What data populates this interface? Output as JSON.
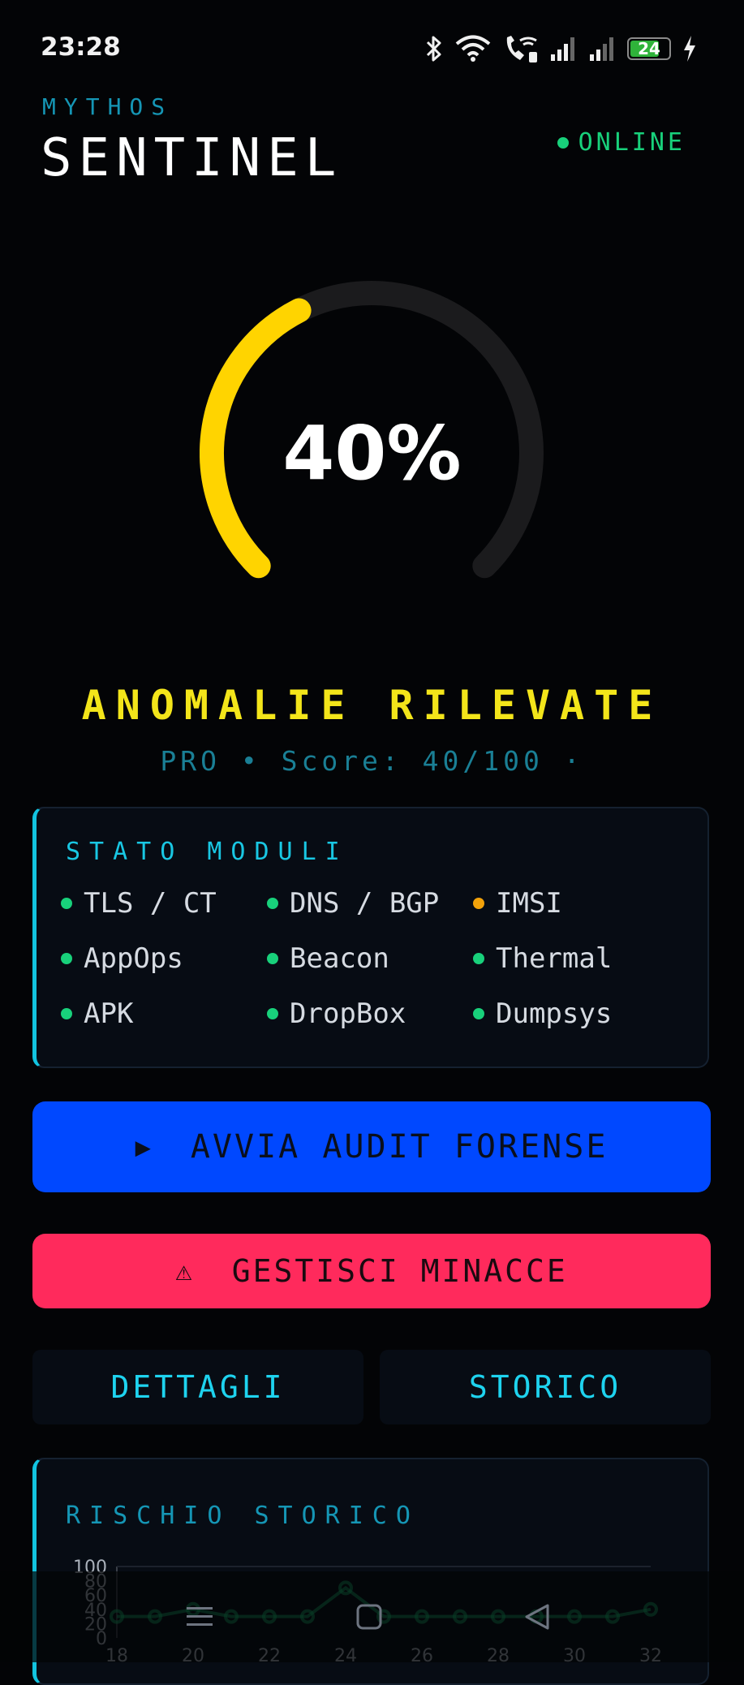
{
  "status_bar": {
    "time": "23:28",
    "battery_level": "24",
    "icons": [
      "bluetooth-icon",
      "wifi-icon",
      "wifi-call-icon",
      "signal-icon",
      "signal-icon",
      "battery-icon",
      "charging-icon"
    ]
  },
  "header": {
    "subtitle": "MYTHOS",
    "title": "SENTINEL",
    "status": "ONLINE"
  },
  "gauge": {
    "value_text": "40%",
    "value": 40,
    "max": 100,
    "color": "#ffd400"
  },
  "status": {
    "title": "ANOMALIE RILEVATE",
    "subtitle": "PRO • Score: 40/100 ·"
  },
  "modules": {
    "title": "STATO MODULI",
    "items": [
      {
        "label": "TLS / CT",
        "color": "#18d17b"
      },
      {
        "label": "DNS / BGP",
        "color": "#18d17b"
      },
      {
        "label": "IMSI",
        "color": "#f2a20a"
      },
      {
        "label": "AppOps",
        "color": "#18d17b"
      },
      {
        "label": "Beacon",
        "color": "#18d17b"
      },
      {
        "label": "Thermal",
        "color": "#18d17b"
      },
      {
        "label": "APK",
        "color": "#18d17b"
      },
      {
        "label": "DropBox",
        "color": "#18d17b"
      },
      {
        "label": "Dumpsys",
        "color": "#18d17b"
      }
    ]
  },
  "actions": {
    "audit_icon": "▶",
    "audit_label": "AVVIA AUDIT FORENSE",
    "threats_icon": "⚠",
    "threats_label": "GESTISCI MINACCE",
    "details_label": "DETTAGLI",
    "history_label": "STORICO"
  },
  "history": {
    "title": "RISCHIO STORICO"
  },
  "chart_data": {
    "type": "line",
    "title": "RISCHIO STORICO",
    "x": [
      18,
      19,
      20,
      21,
      22,
      23,
      24,
      25,
      26,
      27,
      28,
      29,
      30,
      31,
      32
    ],
    "x_ticks": [
      "18",
      "20",
      "22",
      "24",
      "26",
      "28",
      "30",
      "32"
    ],
    "y_ticks": [
      "100",
      "80",
      "60",
      "40",
      "20",
      "0"
    ],
    "series": [
      {
        "values": [
          30,
          30,
          40,
          30,
          30,
          30,
          70,
          30,
          30,
          30,
          30,
          30,
          30,
          30,
          40
        ],
        "color": "#18d17b"
      }
    ],
    "ylim": [
      0,
      100
    ],
    "grid": false
  }
}
